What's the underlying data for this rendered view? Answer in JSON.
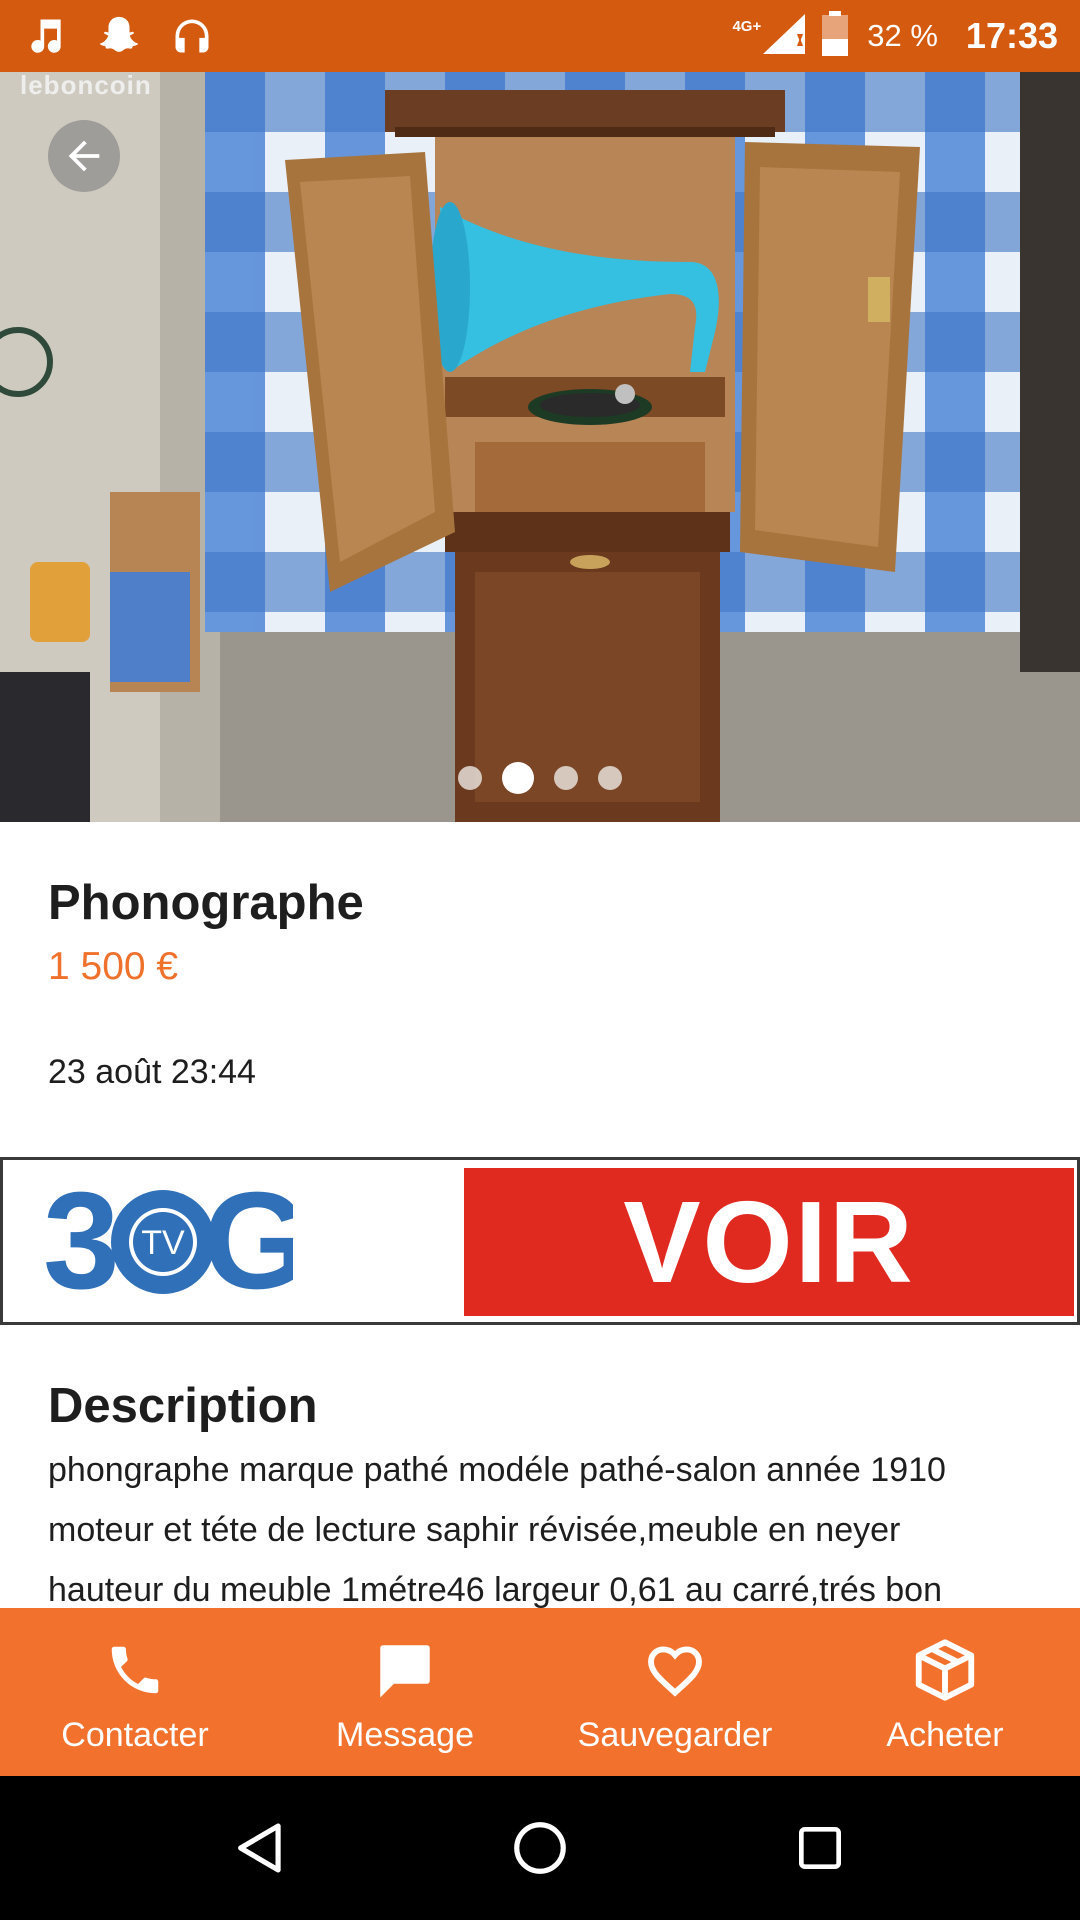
{
  "status_bar": {
    "left_icons": [
      "music-note-icon",
      "snapchat-ghost-icon",
      "headphones-icon"
    ],
    "network": "4G+",
    "battery": "32 %",
    "time": "17:33",
    "background": "#d35a0e"
  },
  "photo": {
    "watermark": "leboncoin",
    "page_count": 4,
    "active_index": 1,
    "description": "Wooden phonograph cabinet with turquoise horn"
  },
  "listing": {
    "title": "Phonographe",
    "price": "1 500 €",
    "date": "23 août 23:44",
    "price_color": "#f0712c"
  },
  "ad": {
    "logo_letters": "3 TV G",
    "logo_mid": "TV",
    "cta": "VOIR",
    "cta_color": "#e02a20"
  },
  "description": {
    "heading": "Description",
    "lines": [
      "phongraphe marque pathé modéle pathé-salon année 1910",
      "moteur et téte de lecture saphir révisée,meuble en neyer",
      "hauteur du meuble 1métre46 largeur 0,61 au carré,trés bon"
    ]
  },
  "actions": [
    {
      "label": "Contacter",
      "icon": "phone-icon"
    },
    {
      "label": "Message",
      "icon": "message-icon"
    },
    {
      "label": "Sauvegarder",
      "icon": "heart-icon"
    },
    {
      "label": "Acheter",
      "icon": "package-icon"
    }
  ],
  "actions_color": "#f2722d",
  "nav": [
    "back-triangle-icon",
    "home-circle-icon",
    "recents-square-icon"
  ]
}
